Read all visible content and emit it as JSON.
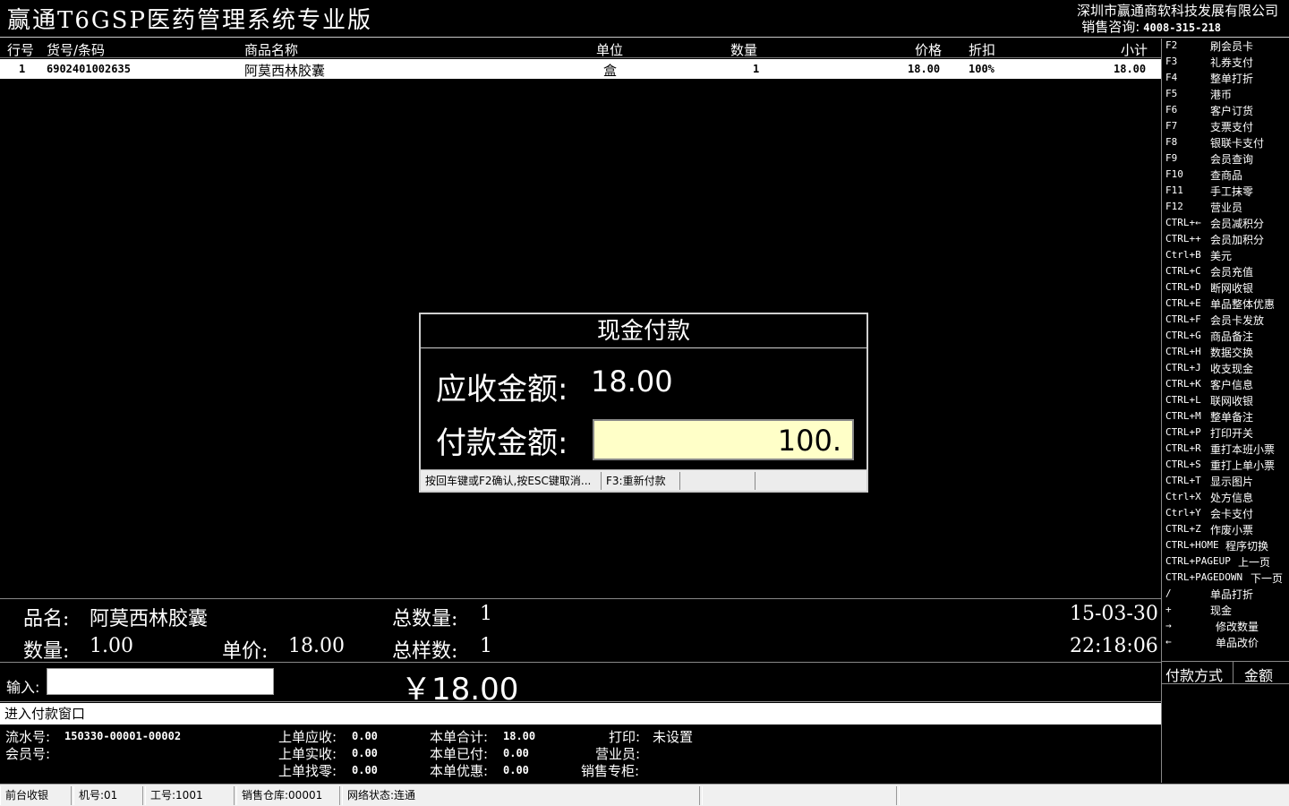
{
  "header": {
    "app_title": "赢通T6GSP医药管理系统专业版",
    "company": "深圳市赢通商软科技发展有限公司",
    "hotline_label": "销售咨询:",
    "hotline_number": "4008-315-218"
  },
  "table": {
    "columns": [
      "行号",
      "货号/条码",
      "商品名称",
      "单位",
      "数量",
      "价格",
      "折扣",
      "小计"
    ],
    "rows": [
      {
        "line": "1",
        "barcode": "6902401002635",
        "name": "阿莫西林胶囊",
        "unit": "盒",
        "qty": "1",
        "price": "18.00",
        "discount": "100%",
        "subtotal": "18.00"
      }
    ]
  },
  "function_keys": [
    {
      "key": "F2",
      "label": "刷会员卡"
    },
    {
      "key": "F3",
      "label": "礼券支付"
    },
    {
      "key": "F4",
      "label": "整单打折"
    },
    {
      "key": "F5",
      "label": "港币"
    },
    {
      "key": "F6",
      "label": "客户订货"
    },
    {
      "key": "F7",
      "label": "支票支付"
    },
    {
      "key": "F8",
      "label": "银联卡支付"
    },
    {
      "key": "F9",
      "label": "会员查询"
    },
    {
      "key": "F10",
      "label": "查商品"
    },
    {
      "key": "F11",
      "label": "手工抹零"
    },
    {
      "key": "F12",
      "label": "营业员"
    },
    {
      "key": "CTRL+←",
      "label": "会员减积分"
    },
    {
      "key": "CTRL++",
      "label": "会员加积分"
    },
    {
      "key": "Ctrl+B",
      "label": "美元"
    },
    {
      "key": "CTRL+C",
      "label": "会员充值"
    },
    {
      "key": "CTRL+D",
      "label": "断网收银"
    },
    {
      "key": "CTRL+E",
      "label": "单品整体优惠"
    },
    {
      "key": "CTRL+F",
      "label": "会员卡发放"
    },
    {
      "key": "CTRL+G",
      "label": "商品备注"
    },
    {
      "key": "CTRL+H",
      "label": "数据交换"
    },
    {
      "key": "CTRL+J",
      "label": "收支现金"
    },
    {
      "key": "CTRL+K",
      "label": "客户信息"
    },
    {
      "key": "CTRL+L",
      "label": "联网收银"
    },
    {
      "key": "CTRL+M",
      "label": "整单备注"
    },
    {
      "key": "CTRL+P",
      "label": "打印开关"
    },
    {
      "key": "CTRL+R",
      "label": "重打本班小票"
    },
    {
      "key": "CTRL+S",
      "label": "重打上单小票"
    },
    {
      "key": "CTRL+T",
      "label": "显示图片"
    },
    {
      "key": "Ctrl+X",
      "label": "处方信息"
    },
    {
      "key": "Ctrl+Y",
      "label": "会卡支付"
    },
    {
      "key": "CTRL+Z",
      "label": "作废小票"
    },
    {
      "key": "CTRL+HOME",
      "label": "程序切换"
    },
    {
      "key": "CTRL+PAGEUP",
      "label": "上一页"
    },
    {
      "key": "CTRL+PAGEDOWN",
      "label": "下一页"
    },
    {
      "key": "/",
      "label": "单品打折"
    },
    {
      "key": "+",
      "label": "现金"
    },
    {
      "key": "→",
      "label": "修改数量"
    },
    {
      "key": "←",
      "label": "单品改价"
    }
  ],
  "dialog": {
    "title": "现金付款",
    "due_label": "应收金额:",
    "due_value": "18.00",
    "pay_label": "付款金额:",
    "pay_value": "100.",
    "status_hint": "按回车键或F2确认,按ESC键取消...",
    "status_f3": "F3:重新付款",
    "status_3": "",
    "status_4": ""
  },
  "info": {
    "name_label": "品名:",
    "name_value": "阿莫西林胶囊",
    "qty_label": "数量:",
    "qty_value": "1.00",
    "price_label": "单价:",
    "price_value": "18.00",
    "total_qty_label": "总数量:",
    "total_qty_value": "1",
    "total_kinds_label": "总样数:",
    "total_kinds_value": "1",
    "date": "15-03-30",
    "time": "22:18:06"
  },
  "input": {
    "label": "输入:",
    "value": "",
    "total_display": "￥18.00"
  },
  "payment_methods": {
    "col_method": "付款方式",
    "col_amount": "金额"
  },
  "message": "进入付款窗口",
  "summary": {
    "serial_label": "流水号:",
    "serial_value": "150330-00001-00002",
    "member_label": "会员号:",
    "member_value": "",
    "prev_due_label": "上单应收:",
    "prev_due_value": "0.00",
    "prev_paid_label": "上单实收:",
    "prev_paid_value": "0.00",
    "prev_change_label": "上单找零:",
    "prev_change_value": "0.00",
    "cur_total_label": "本单合计:",
    "cur_total_value": "18.00",
    "cur_paid_label": "本单已付:",
    "cur_paid_value": "0.00",
    "cur_discount_label": "本单优惠:",
    "cur_discount_value": "0.00",
    "print_label": "打印:",
    "print_value": "未设置",
    "clerk_label": "营业员:",
    "clerk_value": "",
    "counter_label": "销售专柜:",
    "counter_value": ""
  },
  "status_bar": {
    "mode": "前台收银",
    "machine": "机号:01",
    "worker": "工号:1001",
    "warehouse": "销售仓库:00001",
    "network": "网络状态:连通"
  }
}
